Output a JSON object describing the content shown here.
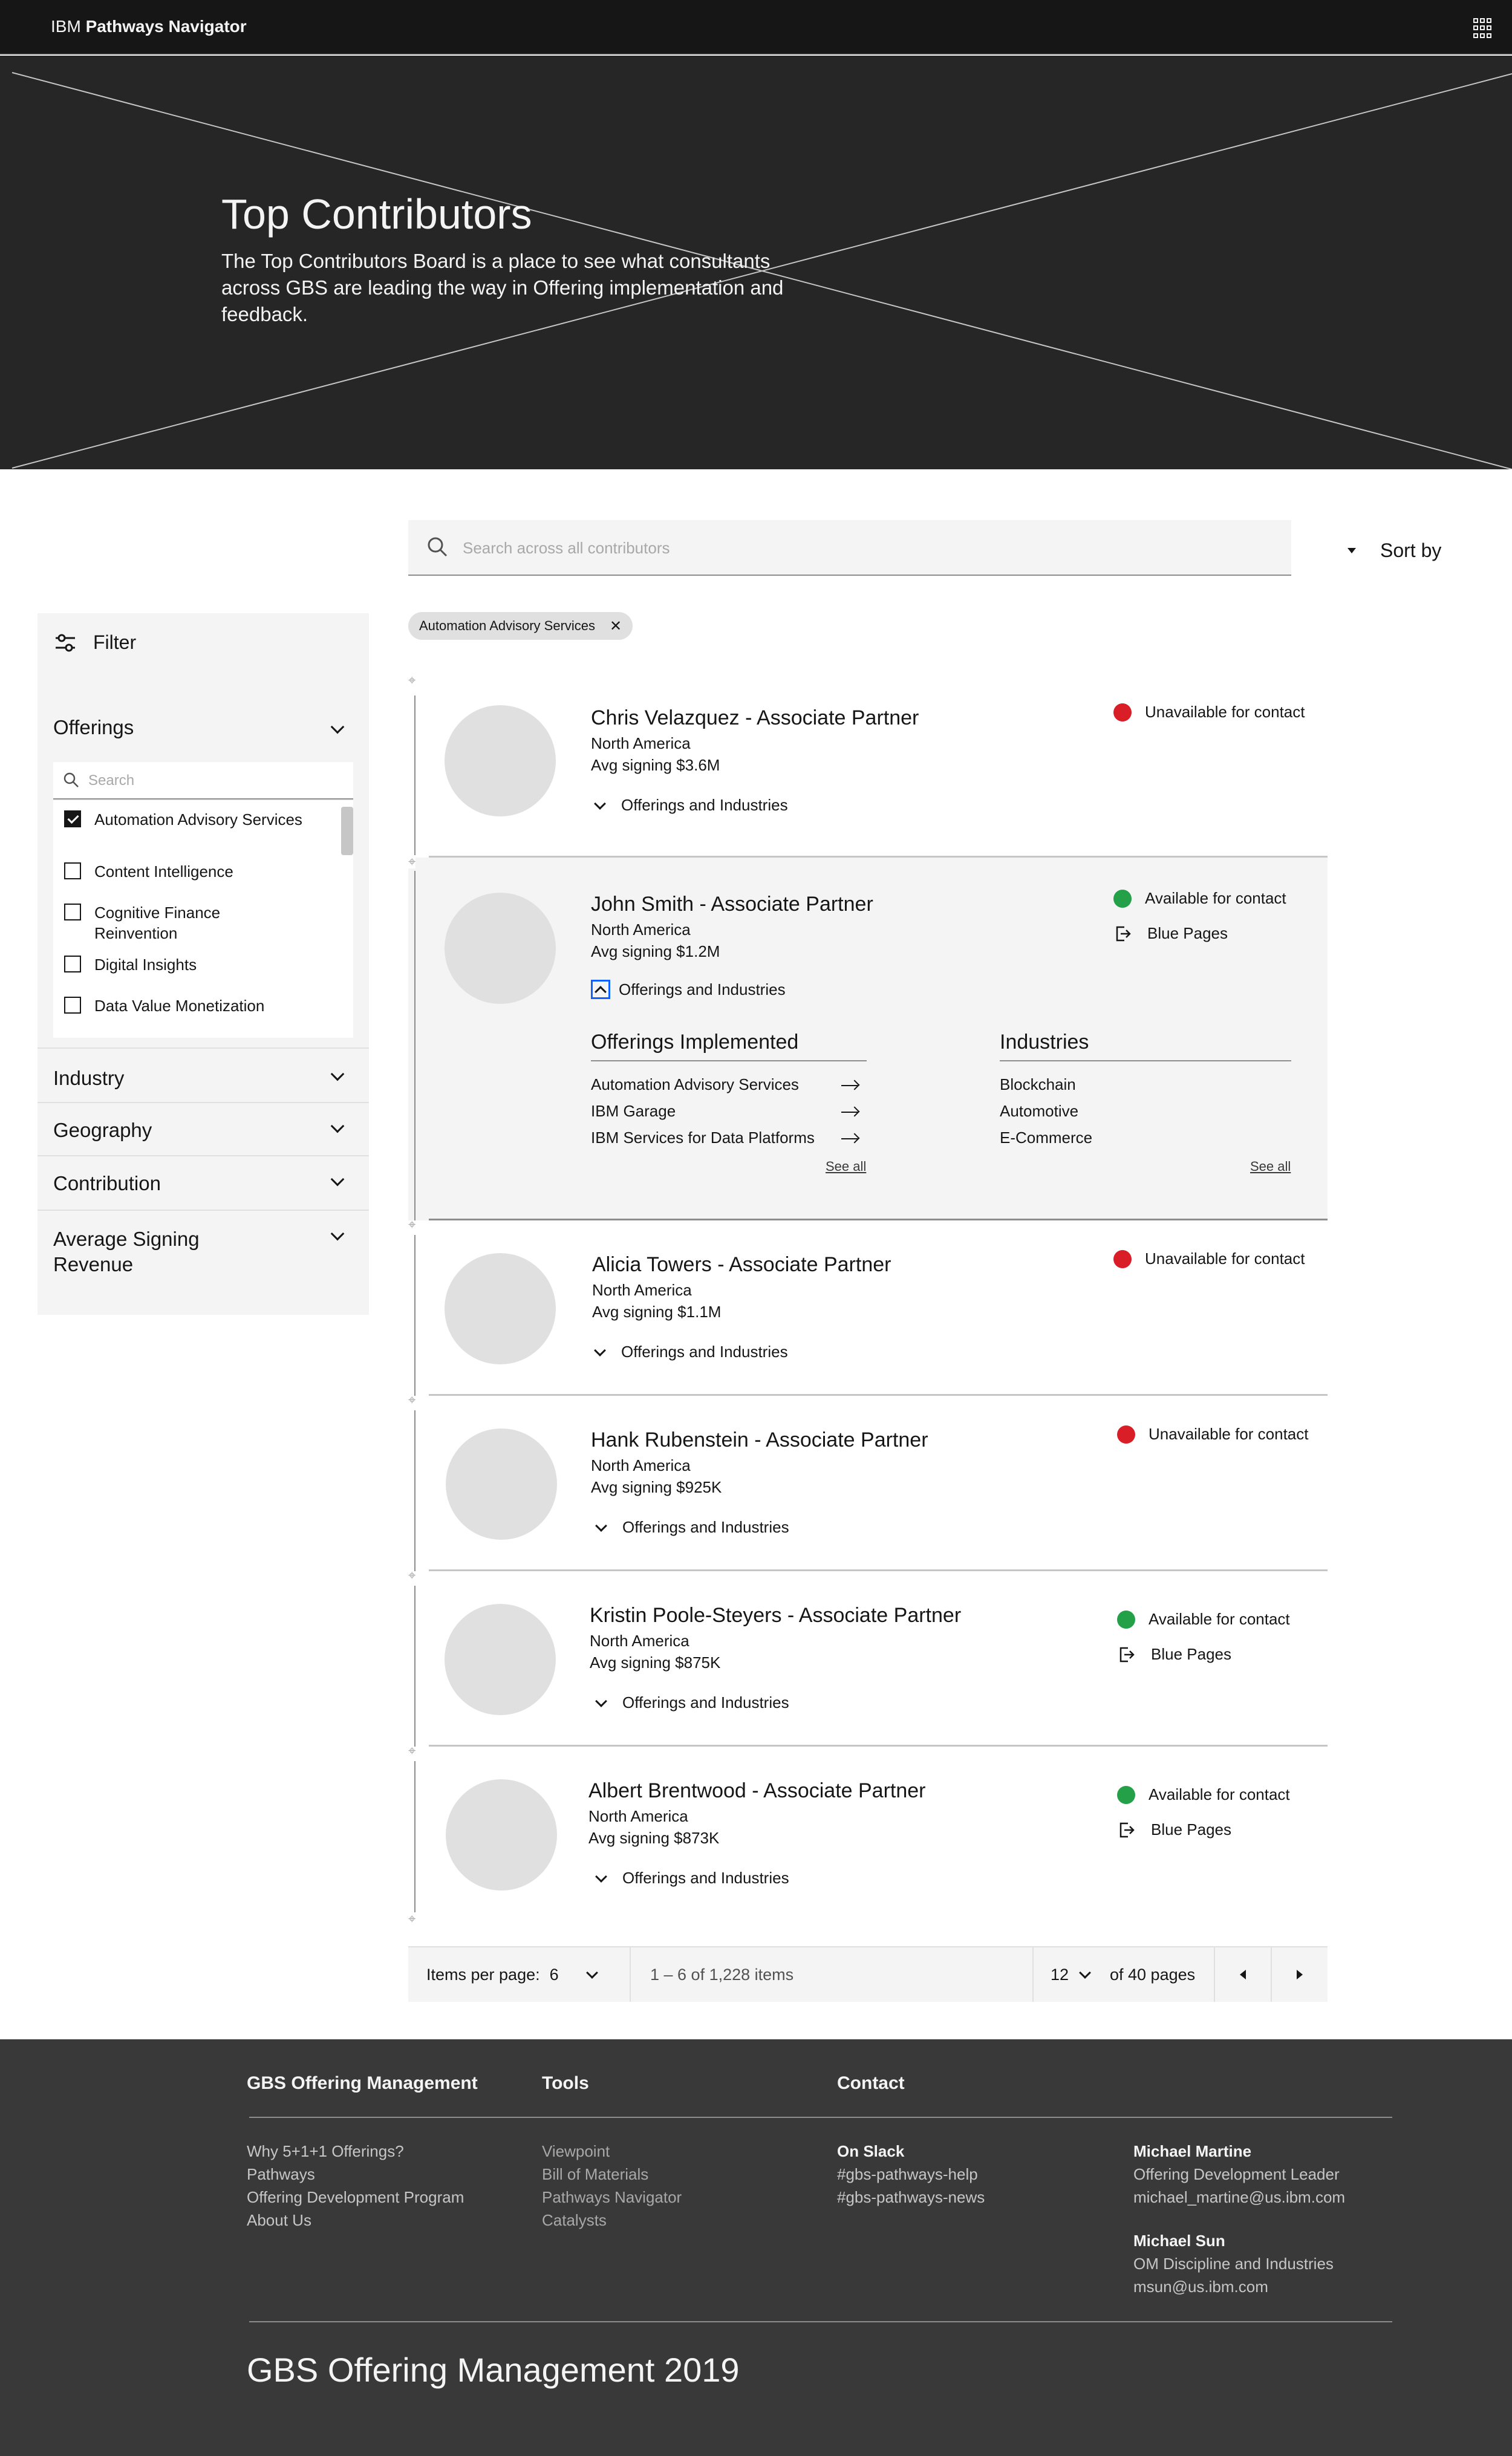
{
  "header": {
    "brand_prefix": "IBM",
    "brand_name": "Pathways Navigator",
    "apps_icon": "app-switcher-icon"
  },
  "hero": {
    "title": "Top Contributors",
    "description": "The Top Contributors Board is a place to see what consultants across GBS are leading the way in Offering implementation and feedback."
  },
  "search": {
    "placeholder": "Search across all contributors",
    "value": ""
  },
  "sort": {
    "label": "Sort by"
  },
  "active_filters": [
    {
      "label": "Automation Advisory Services"
    }
  ],
  "filter": {
    "title": "Filter",
    "sections": {
      "offerings": {
        "title": "Offerings",
        "search_placeholder": "Search",
        "options": [
          {
            "label": "Automation Advisory Services",
            "checked": true
          },
          {
            "label": "Content Intelligence",
            "checked": false
          },
          {
            "label": "Cognitive Finance Reinvention",
            "checked": false
          },
          {
            "label": "Digital Insights",
            "checked": false
          },
          {
            "label": "Data Value Monetization",
            "checked": false
          }
        ]
      },
      "industry": {
        "title": "Industry"
      },
      "geography": {
        "title": "Geography"
      },
      "contribution": {
        "title": "Contribution"
      },
      "avg_revenue": {
        "title": "Average Signing Revenue"
      }
    }
  },
  "contributors": [
    {
      "name": "Chris Velazquez - Associate Partner",
      "region": "North America",
      "signing": "Avg signing $3.6M",
      "status": "Unavailable for contact",
      "toggle": "Offerings and Industries"
    },
    {
      "name": "John Smith - Associate Partner",
      "region": "North America",
      "signing": "Avg signing $1.2M",
      "status": "Available for contact",
      "blue_pages": "Blue Pages",
      "toggle": "Offerings and Industries",
      "expanded": {
        "offerings_title": "Offerings Implemented",
        "offerings": [
          "Automation Advisory Services",
          "IBM Garage",
          "IBM Services for Data Platforms"
        ],
        "industries_title": "Industries",
        "industries": [
          "Blockchain",
          "Automotive",
          "E-Commerce"
        ],
        "see_all": "See all"
      }
    },
    {
      "name": "Alicia Towers - Associate Partner",
      "region": "North America",
      "signing": "Avg signing $1.1M",
      "status": "Unavailable for contact",
      "toggle": "Offerings and Industries"
    },
    {
      "name": "Hank Rubenstein - Associate Partner",
      "region": "North America",
      "signing": "Avg signing $925K",
      "status": "Unavailable for contact",
      "toggle": "Offerings and Industries"
    },
    {
      "name": "Kristin Poole-Steyers - Associate Partner",
      "region": "North America",
      "signing": "Avg signing $875K",
      "status": "Available for contact",
      "blue_pages": "Blue Pages",
      "toggle": "Offerings and Industries"
    },
    {
      "name": "Albert Brentwood - Associate Partner",
      "region": "North America",
      "signing": "Avg signing $873K",
      "status": "Available for contact",
      "blue_pages": "Blue Pages",
      "toggle": "Offerings and Industries"
    }
  ],
  "pagination": {
    "items_per_page_label": "Items per page:",
    "items_per_page": "6",
    "range": "1 – 6 of 1,228 items",
    "page": "12",
    "of_pages": "of 40 pages"
  },
  "footer": {
    "col1_title": "GBS Offering Management",
    "col1_links": [
      "Why 5+1+1 Offerings?",
      "Pathways",
      "Offering Development Program",
      "About Us"
    ],
    "col2_title": "Tools",
    "col2_links": [
      "Viewpoint",
      "Bill of Materials",
      "Pathways Navigator",
      "Catalysts"
    ],
    "col3_title": "Contact",
    "slack_title": "On Slack",
    "slack_links": [
      "#gbs-pathways-help",
      "#gbs-pathways-news"
    ],
    "contacts": [
      {
        "name": "Michael Martine",
        "role": "Offering Development Leader",
        "email": "michael_martine@us.ibm.com"
      },
      {
        "name": "Michael Sun",
        "role": "OM Discipline and Industries",
        "email": "msun@us.ibm.com"
      }
    ],
    "copyright": "GBS Offering Management 2019"
  },
  "colors": {
    "unavailable": "#da1e28",
    "available": "#24a148",
    "focus": "#0f62fe"
  }
}
